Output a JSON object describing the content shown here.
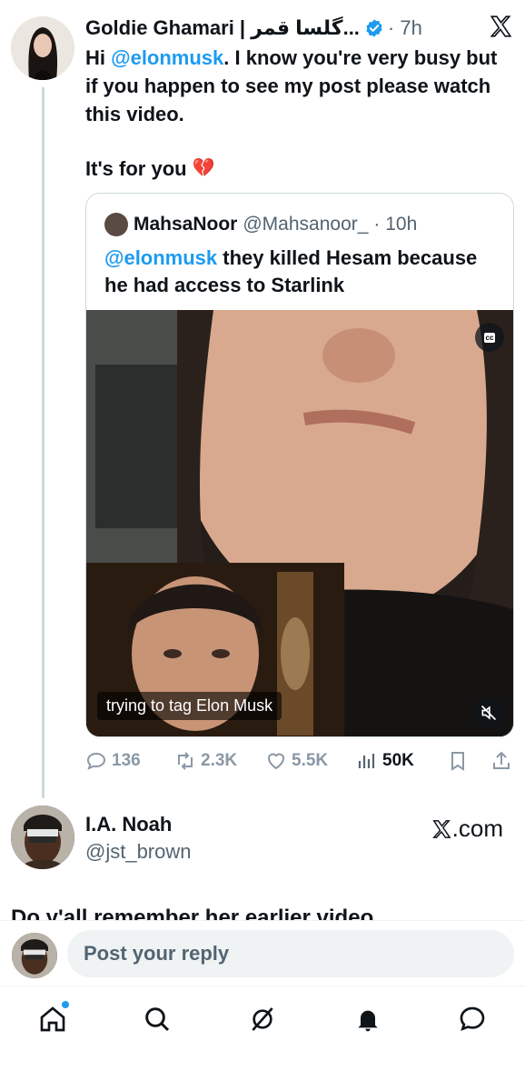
{
  "tweet": {
    "author": "Goldie Ghamari | گلسا قمر...",
    "time": "7h",
    "text_prefix": "Hi ",
    "mention": "@elonmusk",
    "text_rest": ". I know you're very busy but if you happen to see my post please watch this video.",
    "line2": "It's for you",
    "line2_emoji": "💔"
  },
  "quote": {
    "author": "MahsaNoor",
    "handle": "@Mahsanoor_",
    "time": "10h",
    "mention": "@elonmusk",
    "text": " they killed Hesam because he had access to Starlink",
    "video_caption": "trying to tag Elon Musk",
    "cc_label": "cc"
  },
  "actions": {
    "replies": "136",
    "reposts": "2.3K",
    "likes": "5.5K",
    "views": "50K"
  },
  "next_tweet": {
    "author": "I.A. Noah",
    "handle": "@jst_brown",
    "source": ".com",
    "cutoff_text": "Do y'all remember her earlier video"
  },
  "reply_bar": {
    "placeholder": "Post your reply"
  },
  "nav": {
    "items": [
      "home-icon",
      "search-icon",
      "grok-icon",
      "notifications-icon",
      "messages-icon"
    ]
  },
  "colors": {
    "accent": "#1d9bf0",
    "muted": "#536471",
    "border": "#cfd9de"
  }
}
